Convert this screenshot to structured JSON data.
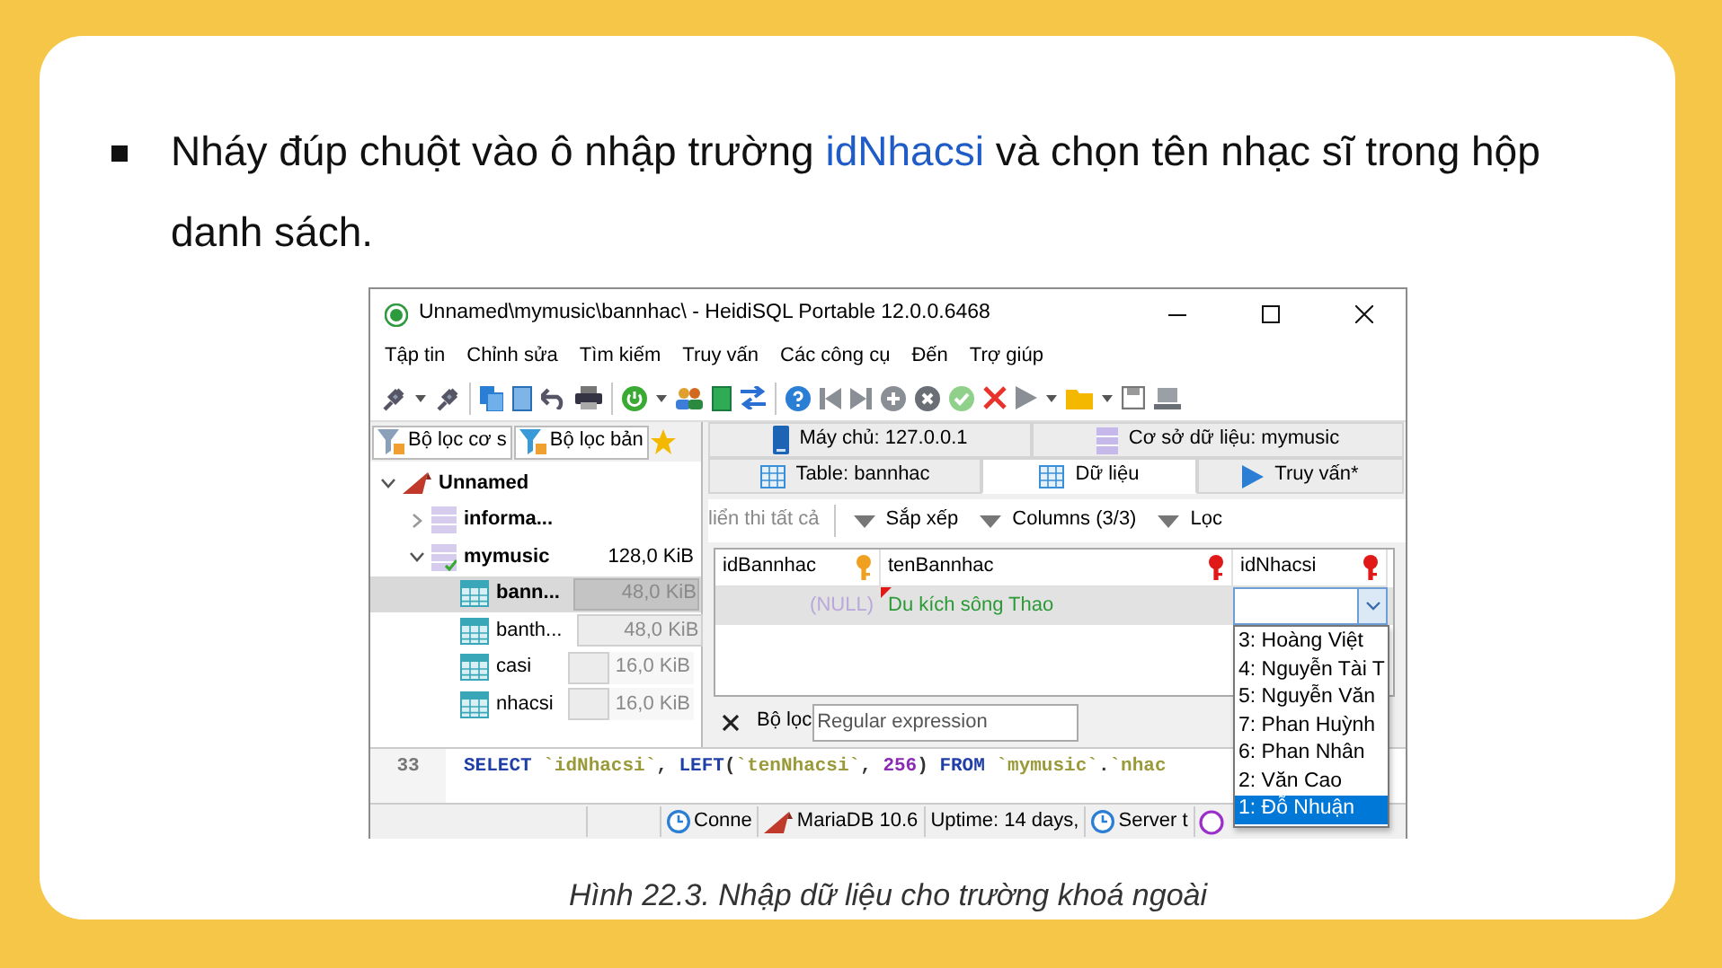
{
  "slide": {
    "bullet": [
      {
        "text": "Nháy đúp chuột vào ô nhập trường ",
        "highlight": false
      },
      {
        "text": "idNhacsi",
        "highlight": true
      },
      {
        "text": " và chọn tên nhạc sĩ trong hộp danh sách.",
        "highlight": false
      }
    ],
    "caption": "Hình 22.3. Nhập dữ liệu cho trường khoá ngoài"
  },
  "window": {
    "title": "Unnamed\\mymusic\\bannhac\\ - HeidiSQL Portable 12.0.0.6468",
    "menu": [
      "Tập tin",
      "Chỉnh sửa",
      "Tìm kiếm",
      "Truy vấn",
      "Các công cụ",
      "Đến",
      "Trợ giúp"
    ]
  },
  "filter_tabs": [
    "Bộ lọc cơ s",
    "Bộ lọc bản"
  ],
  "tree": [
    {
      "label": "Unnamed",
      "kind": "server",
      "expanded": true,
      "selected": false,
      "children": [
        {
          "label": "informa...",
          "kind": "database",
          "expanded": false,
          "selected": false
        },
        {
          "label": "mymusic",
          "kind": "database",
          "size": "128,0 KiB",
          "expanded": true,
          "selected": false,
          "children": [
            {
              "label": "bann...",
              "kind": "table",
              "size": "48,0 KiB",
              "level": 1,
              "selected": true
            },
            {
              "label": "banth...",
              "kind": "table",
              "size": "48,0 KiB",
              "level": 1,
              "selected": false
            },
            {
              "label": "casi",
              "kind": "table",
              "size": "16,0 KiB",
              "level": 0.33,
              "selected": false
            },
            {
              "label": "nhacsi",
              "kind": "table",
              "size": "16,0 KiB",
              "level": 0.33,
              "selected": false
            }
          ]
        }
      ]
    }
  ],
  "server_tabs": [
    {
      "label": "Máy chủ: 127.0.0.1",
      "kind": "server",
      "selected": false
    },
    {
      "label": "Cơ sở dữ liệu: mymusic",
      "kind": "database",
      "selected": false
    }
  ],
  "tabs": [
    {
      "label": "Table: bannhac",
      "kind": "table",
      "selected": false
    },
    {
      "label": "Dữ liệu",
      "kind": "data",
      "selected": true
    },
    {
      "label": "Truy vấn*",
      "kind": "query",
      "selected": false
    }
  ],
  "data_toolbar": [
    {
      "label": "liển thi tất cả",
      "kind": "text"
    },
    {
      "label": "Sắp xếp",
      "kind": "menu"
    },
    {
      "label": "Columns (3/3)",
      "kind": "menu"
    },
    {
      "label": "Lọc",
      "kind": "menu"
    }
  ],
  "grid": {
    "columns": [
      {
        "name": "idBannhac",
        "kind": "primary"
      },
      {
        "name": "tenBannhac",
        "kind": "foreign"
      },
      {
        "name": "idNhacsi",
        "kind": "foreign"
      }
    ],
    "rows": [
      {
        "selected": true,
        "cells": [
          {
            "text": "(NULL)",
            "kind": "null"
          },
          {
            "text": "Du kích sông Thao",
            "kind": "modified"
          },
          {
            "kind": "editor"
          }
        ]
      }
    ]
  },
  "editor": {
    "options": [
      {
        "label": "3: Hoàng Việt",
        "selected": false
      },
      {
        "label": "4: Nguyễn Tài T",
        "selected": false
      },
      {
        "label": "5: Nguyễn Văn",
        "selected": false
      },
      {
        "label": "7: Phan Huỳnh",
        "selected": false
      },
      {
        "label": "6: Phan Nhân",
        "selected": false
      },
      {
        "label": "2: Văn Cao",
        "selected": false
      },
      {
        "label": "1: Đỗ Nhuận",
        "selected": true
      }
    ]
  },
  "filter": {
    "label": "Bộ lọc",
    "placeholder": "Regular expression"
  },
  "sql": {
    "line": "33",
    "tokens": [
      {
        "text": "SELECT",
        "kind": "keyword"
      },
      {
        "text": " `idNhacsi`",
        "kind": "ident"
      },
      {
        "text": ", ",
        "kind": "plain"
      },
      {
        "text": "LEFT",
        "kind": "keyword"
      },
      {
        "text": "(",
        "kind": "plain"
      },
      {
        "text": "`tenNhacsi`",
        "kind": "ident"
      },
      {
        "text": ", ",
        "kind": "plain"
      },
      {
        "text": "256",
        "kind": "number"
      },
      {
        "text": ") ",
        "kind": "plain"
      },
      {
        "text": "FROM",
        "kind": "keyword"
      },
      {
        "text": " `mymusic`",
        "kind": "ident"
      },
      {
        "text": ".",
        "kind": "plain"
      },
      {
        "text": "`nhac",
        "kind": "ident"
      }
    ]
  },
  "status_bar": [
    {
      "text": "Conne",
      "kind": "clock"
    },
    {
      "text": "MariaDB 10.6",
      "kind": "server"
    },
    {
      "text": "Uptime: 14 days,",
      "kind": "plain"
    },
    {
      "text": "Server t",
      "kind": "clock"
    }
  ]
}
